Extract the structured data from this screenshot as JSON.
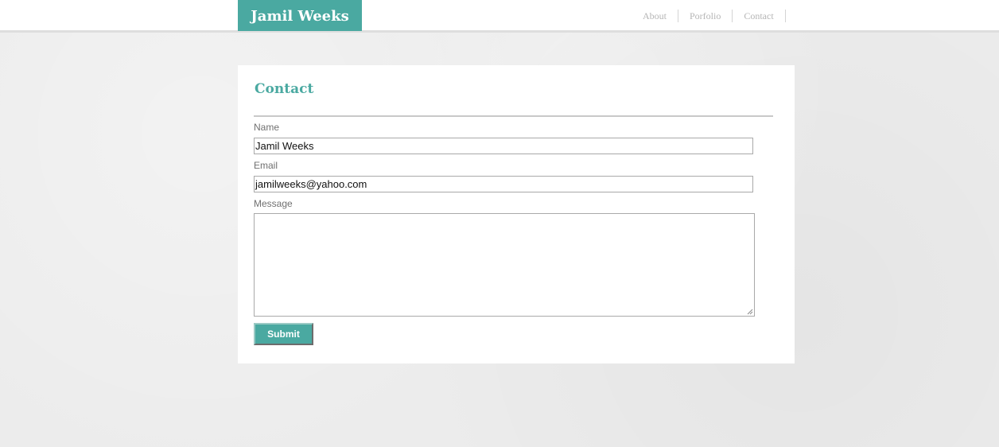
{
  "header": {
    "logo_text": "Jamil Weeks",
    "nav": [
      "About",
      "Porfolio",
      "Contact"
    ]
  },
  "contact": {
    "title": "Contact",
    "name_label": "Name",
    "name_value": "Jamil Weeks",
    "email_label": "Email",
    "email_value": "jamilweeks@yahoo.com",
    "message_label": "Message",
    "message_value": "",
    "submit_label": "Submit"
  },
  "colors": {
    "accent": "#4aa9a1",
    "background": "#ececec",
    "card": "#ffffff"
  }
}
